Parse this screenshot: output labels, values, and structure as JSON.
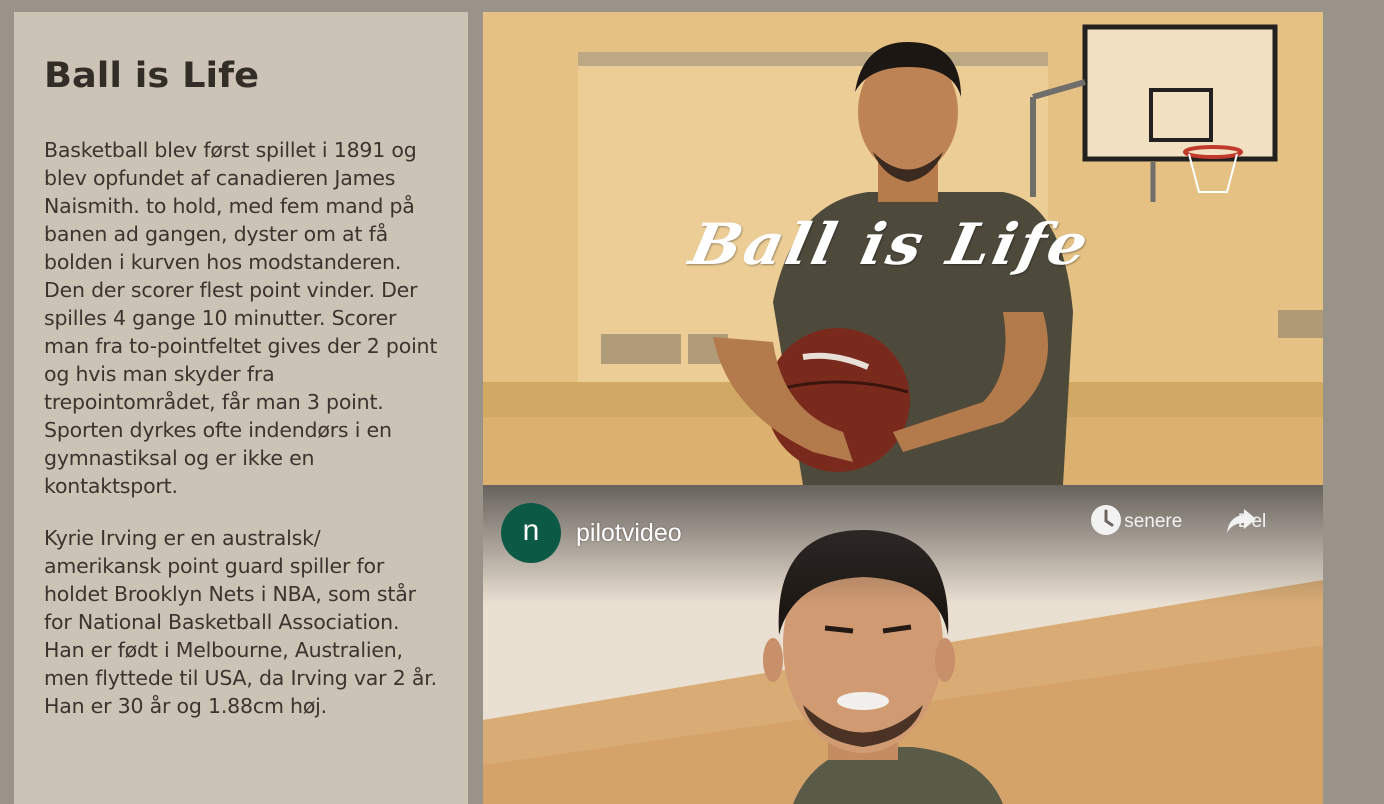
{
  "sidebar": {
    "title": "Ball is Life",
    "paragraphs": [
      "Basketball blev først spillet i 1891 og blev opfundet af canadieren James Naismith. to hold, med fem mand på banen ad gangen, dyster om at få bolden i kurven hos modstanderen. Den der scorer flest point vinder. Der spilles 4 gange 10 minutter. Scorer man fra to-pointfeltet gives der 2 point og hvis man skyder fra trepointområdet, får man 3 point. Sporten dyrkes ofte indendørs i en gymnastiksal og er ikke en kontaktsport.",
      "Kyrie Irving er en australsk/ amerikansk point guard spiller for holdet Brooklyn Nets i NBA, som står for National Basketball Association. Han er født i Melbourne, Australien, men flyttede til USA, da Irving var 2 år. Han er 30 år og 1.88cm høj."
    ]
  },
  "hero": {
    "overlay_title": "Ball is Life"
  },
  "video": {
    "channel_initial": "n",
    "title": "pilotvideo",
    "watch_later_label": "Se senere",
    "share_label": "Del",
    "watch_later_icon": "clock-icon",
    "share_icon": "share-arrow-icon"
  },
  "colors": {
    "page_bg": "#99938a",
    "sidebar_bg": "#cbc3b5",
    "avatar_bg": "#0c5a46"
  }
}
